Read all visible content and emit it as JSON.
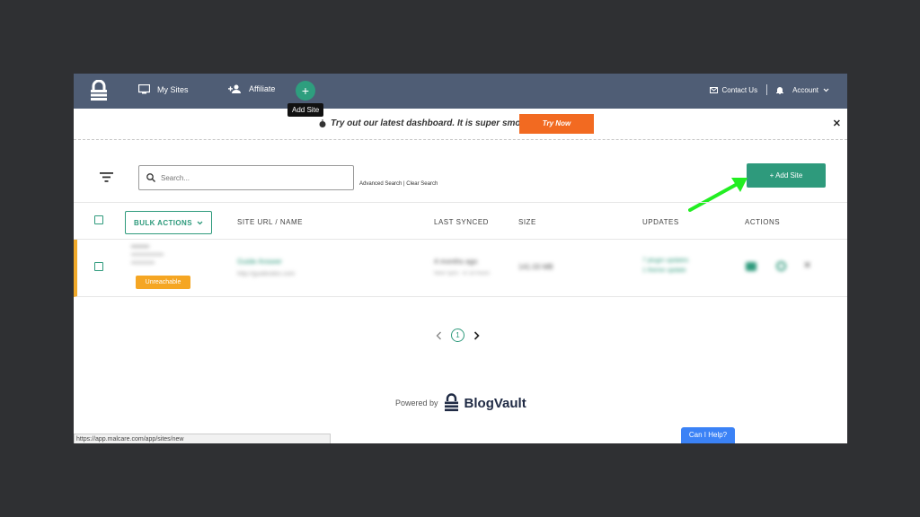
{
  "nav": {
    "my_sites": "My Sites",
    "affiliate": "Affiliate",
    "add_tooltip": "Add Site",
    "contact": "Contact Us",
    "account": "Account"
  },
  "banner": {
    "text": "Try out our latest dashboard. It is super smooth!",
    "cta": "Try Now"
  },
  "toolbar": {
    "search_placeholder": "Search...",
    "advanced_search": "Advanced Search",
    "clear_search": "Clear Search",
    "add_site": "+ Add Site"
  },
  "table": {
    "bulk_actions": "BULK ACTIONS",
    "columns": [
      "SITE URL / NAME",
      "LAST SYNCED",
      "SIZE",
      "UPDATES",
      "ACTIONS"
    ],
    "rows": [
      {
        "site_name": "Guide Answer",
        "site_url": "http://guidesites.com",
        "last_synced": "4 months ago",
        "sync_note": "Next Sync : in 18 hours",
        "size": "141.03 MB",
        "updates_1": "7 plugin updates",
        "updates_2": "1 theme update",
        "status": "Unreachable"
      }
    ]
  },
  "pagination": {
    "current": "1"
  },
  "footer": {
    "powered_by": "Powered by",
    "brand": "BlogVault",
    "status_url": "https://app.malcare.com/app/sites/new",
    "help": "Can I Help?"
  },
  "colors": {
    "nav": "#4f5d75",
    "accent": "#2e9a7c",
    "orange": "#f26a21",
    "warning": "#f5a623",
    "arrow": "#22ee22"
  }
}
